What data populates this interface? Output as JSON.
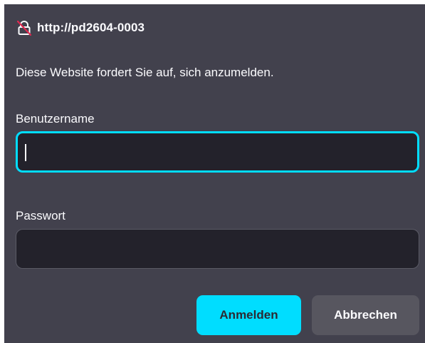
{
  "dialog": {
    "origin": "http://pd2604-0003",
    "lock_icon": "insecure-lock-icon",
    "message": "Diese Website fordert Sie auf, sich anzumelden."
  },
  "username": {
    "label": "Benutzername",
    "value": "",
    "placeholder": ""
  },
  "password": {
    "label": "Passwort",
    "value": "",
    "placeholder": ""
  },
  "buttons": {
    "login_label": "Anmelden",
    "cancel_label": "Abbrechen"
  },
  "colors": {
    "dialog_background": "#42414d",
    "input_background": "#23222b",
    "accent": "#00ddff",
    "insecure_strike": "#e22850"
  }
}
